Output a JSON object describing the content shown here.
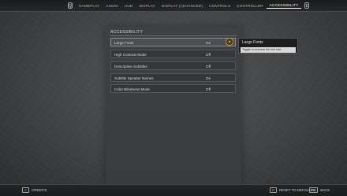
{
  "nav": {
    "prev_key": "Q",
    "next_key": "E",
    "tabs": [
      {
        "label": "GAMEPLAY",
        "active": false
      },
      {
        "label": "AUDIO",
        "active": false
      },
      {
        "label": "HUD",
        "active": false
      },
      {
        "label": "DISPLAY",
        "active": false
      },
      {
        "label": "DISPLAY (ADVANCED)",
        "active": false
      },
      {
        "label": "CONTROLS",
        "active": false
      },
      {
        "label": "CONTROLLER",
        "active": false
      },
      {
        "label": "ACCESSIBILITY",
        "active": true
      }
    ]
  },
  "section": {
    "title": "ACCESSIBILITY",
    "rows": [
      {
        "label": "Large Fonts",
        "value": "On",
        "active": true
      },
      {
        "label": "High Contrast Mode",
        "value": "Off",
        "active": false
      },
      {
        "label": "Descriptive Subtitles",
        "value": "Off",
        "active": false
      },
      {
        "label": "Subtitle Speaker Names",
        "value": "On",
        "active": false
      },
      {
        "label": "Color Blindness Mode",
        "value": "Off",
        "active": false
      }
    ]
  },
  "tooltip": {
    "title": "Large Fonts",
    "body": "Toggle to increase the font size."
  },
  "footer": {
    "credits_key": "C",
    "credits_label": "CREDITS",
    "reset_key": "R",
    "reset_label": "RESET TO DEFAULTS",
    "back_key": "ESC",
    "back_label": "BACK"
  },
  "colors": {
    "accent_cursor": "#c79a3c",
    "active_row": "#4b4d50"
  }
}
